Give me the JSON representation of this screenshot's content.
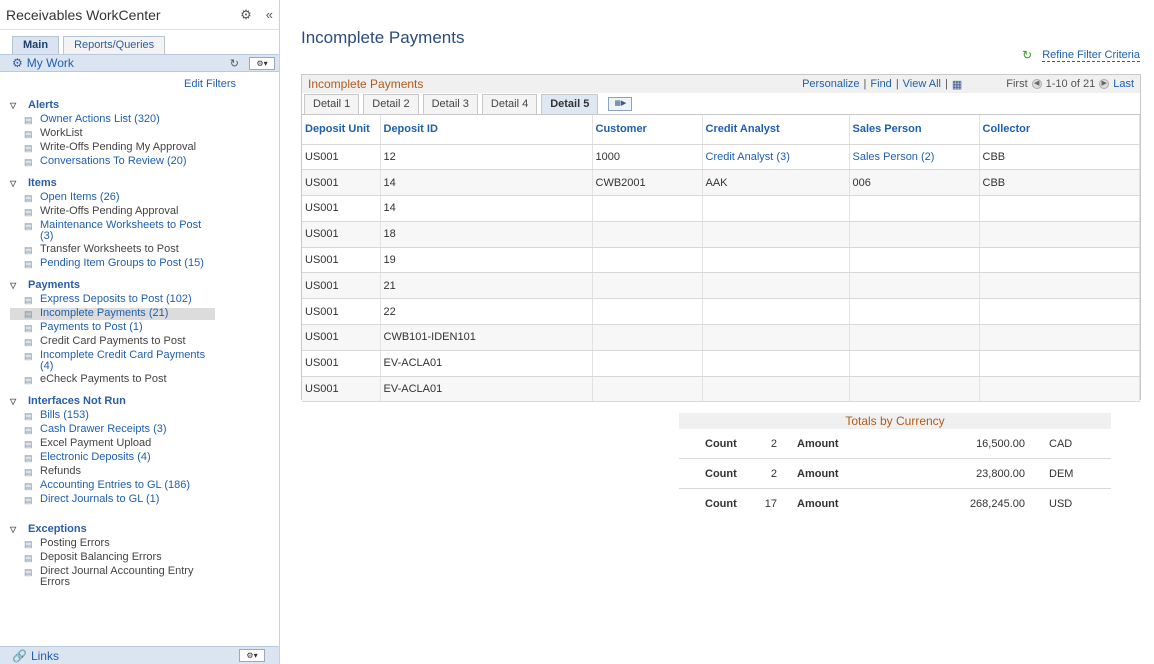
{
  "sidebar": {
    "title": "Receivables WorkCenter",
    "tabs": [
      {
        "label": "Main"
      },
      {
        "label": "Reports/Queries"
      }
    ],
    "mywork_title": "My Work",
    "edit_filters": "Edit Filters",
    "sections": [
      {
        "title": "Alerts",
        "items": [
          {
            "label": "Owner Actions List (320)",
            "link": true
          },
          {
            "label": "WorkList",
            "link": false
          },
          {
            "label": "Write-Offs Pending My Approval",
            "link": false
          },
          {
            "label": "Conversations To Review (20)",
            "link": true
          }
        ]
      },
      {
        "title": "Items",
        "items": [
          {
            "label": "Open Items (26)",
            "link": true
          },
          {
            "label": "Write-Offs Pending Approval",
            "link": false
          },
          {
            "label": "Maintenance Worksheets to Post (3)",
            "link": true
          },
          {
            "label": "Transfer Worksheets to Post",
            "link": false
          },
          {
            "label": "Pending Item Groups to Post (15)",
            "link": true
          }
        ]
      },
      {
        "title": "Payments",
        "items": [
          {
            "label": "Express Deposits to Post (102)",
            "link": true
          },
          {
            "label": "Incomplete Payments (21)",
            "link": true,
            "selected": true
          },
          {
            "label": "Payments to Post (1)",
            "link": true
          },
          {
            "label": "Credit Card Payments to Post",
            "link": false
          },
          {
            "label": "Incomplete Credit Card Payments (4)",
            "link": true
          },
          {
            "label": "eCheck Payments to Post",
            "link": false
          }
        ]
      },
      {
        "title": "Interfaces Not Run",
        "items": [
          {
            "label": "Bills (153)",
            "link": true
          },
          {
            "label": "Cash Drawer Receipts (3)",
            "link": true
          },
          {
            "label": "Excel Payment Upload",
            "link": false
          },
          {
            "label": "Electronic Deposits (4)",
            "link": true
          },
          {
            "label": "Refunds",
            "link": false
          },
          {
            "label": "Accounting Entries to GL (186)",
            "link": true
          },
          {
            "label": "Direct Journals to GL (1)",
            "link": true
          }
        ]
      },
      {
        "title": "Exceptions",
        "items": [
          {
            "label": "Posting Errors",
            "link": false
          },
          {
            "label": "Deposit Balancing Errors",
            "link": false
          },
          {
            "label": "Direct Journal Accounting Entry Errors",
            "link": false
          }
        ]
      }
    ],
    "links_title": "Links"
  },
  "main": {
    "page_title": "Incomplete Payments",
    "refine_filter": "Refine Filter Criteria",
    "grid": {
      "title": "Incomplete Payments",
      "nav": {
        "personalize": "Personalize",
        "find": "Find",
        "view_all": "View All",
        "first": "First",
        "range": "1-10 of 21",
        "last": "Last"
      },
      "tabs": [
        "Detail 1",
        "Detail 2",
        "Detail 3",
        "Detail 4",
        "Detail 5"
      ],
      "columns": [
        "Deposit Unit",
        "Deposit ID",
        "Customer",
        "Credit Analyst",
        "Sales Person",
        "Collector"
      ],
      "rows": [
        [
          "US001",
          "12",
          "1000",
          "Credit Analyst (3)",
          "Sales Person (2)",
          "CBB"
        ],
        [
          "US001",
          "14",
          "CWB2001",
          "AAK",
          "006",
          "CBB"
        ],
        [
          "US001",
          "14",
          "",
          "",
          "",
          ""
        ],
        [
          "US001",
          "18",
          "",
          "",
          "",
          ""
        ],
        [
          "US001",
          "19",
          "",
          "",
          "",
          ""
        ],
        [
          "US001",
          "21",
          "",
          "",
          "",
          ""
        ],
        [
          "US001",
          "22",
          "",
          "",
          "",
          ""
        ],
        [
          "US001",
          "CWB101-IDEN101",
          "",
          "",
          "",
          ""
        ],
        [
          "US001",
          "EV-ACLA01",
          "",
          "",
          "",
          ""
        ],
        [
          "US001",
          "EV-ACLA01",
          "",
          "",
          "",
          ""
        ]
      ]
    },
    "totals": {
      "title": "Totals by Currency",
      "count_label": "Count",
      "amount_label": "Amount",
      "rows": [
        {
          "count": "2",
          "amount": "16,500.00",
          "currency": "CAD"
        },
        {
          "count": "2",
          "amount": "23,800.00",
          "currency": "DEM"
        },
        {
          "count": "17",
          "amount": "268,245.00",
          "currency": "USD"
        }
      ]
    }
  }
}
